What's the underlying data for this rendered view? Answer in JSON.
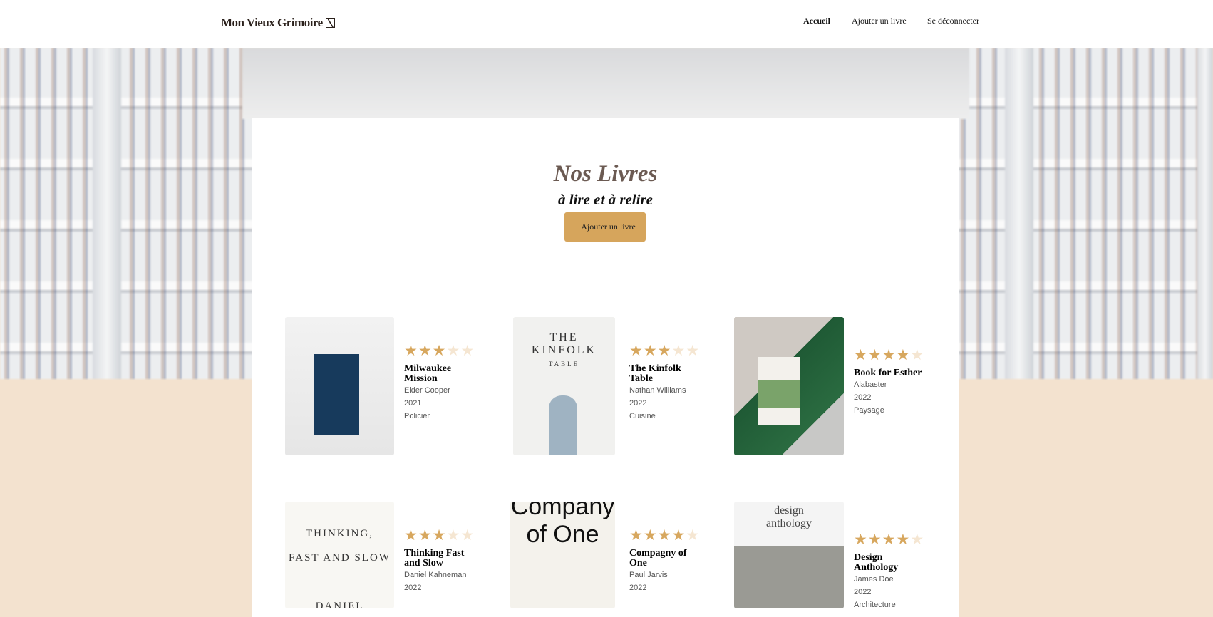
{
  "header": {
    "logo": "Mon Vieux Grimoire",
    "nav": [
      {
        "label": "Accueil",
        "active": true
      },
      {
        "label": "Ajouter un livre",
        "active": false
      },
      {
        "label": "Se déconnecter",
        "active": false
      }
    ]
  },
  "main": {
    "title": "Nos Livres",
    "subtitle": "à lire et à relire",
    "add_button": "+ Ajouter un livre"
  },
  "colors": {
    "accent": "#d6a55c",
    "star_on": "#d7a75e",
    "star_off": "#f5e6d2",
    "background": "#f3e2cf"
  },
  "books": [
    {
      "title": "Milwaukee Mission",
      "author": "Elder Cooper",
      "year": "2021",
      "genre": "Policier",
      "rating": 3
    },
    {
      "title": "The Kinfolk Table",
      "author": "Nathan Williams",
      "year": "2022",
      "genre": "Cuisine",
      "rating": 3
    },
    {
      "title": "Book for Esther",
      "author": "Alabaster",
      "year": "2022",
      "genre": "Paysage",
      "rating": 4
    },
    {
      "title": "Thinking Fast and Slow",
      "author": "Daniel Kahneman",
      "year": "2022",
      "genre": "",
      "rating": 3
    },
    {
      "title": "Compagny of One",
      "author": "Paul Jarvis",
      "year": "2022",
      "genre": "",
      "rating": 4
    },
    {
      "title": "Design Anthology",
      "author": "James Doe",
      "year": "2022",
      "genre": "Architecture",
      "rating": 4
    }
  ]
}
